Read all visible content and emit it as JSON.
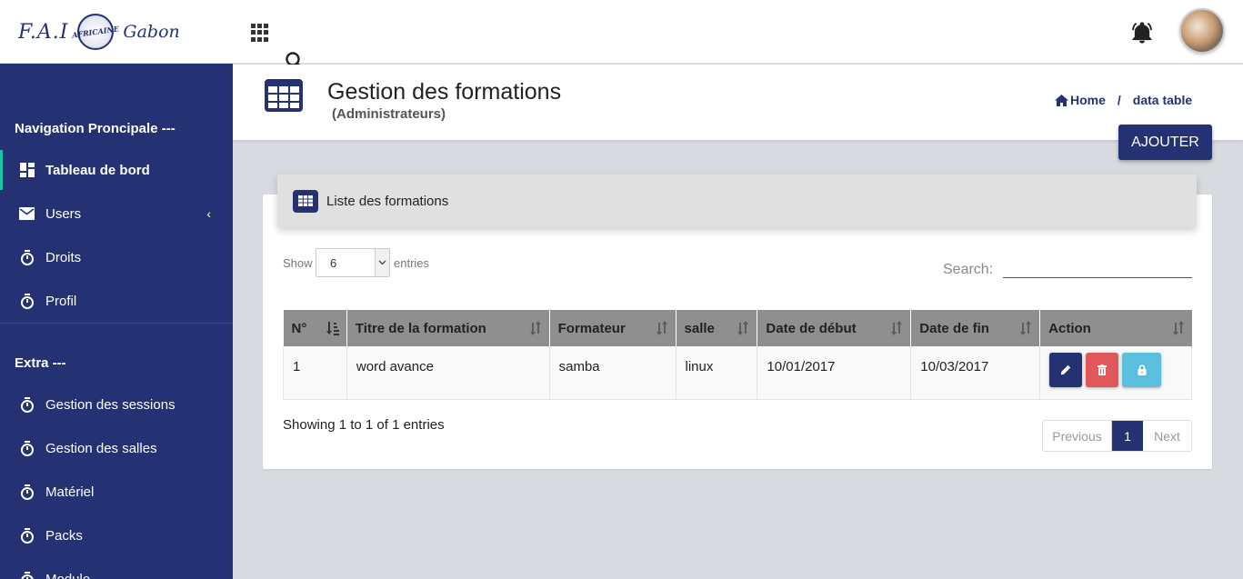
{
  "logo": {
    "left": "F.A.I",
    "emblem": "AFRICAINE",
    "right": "Gabon"
  },
  "sidebar": {
    "heading_main": "Navigation Proncipale ---",
    "items_main": [
      {
        "label": "Tableau de bord",
        "icon": "dashboard-icon",
        "active": true
      },
      {
        "label": "Users",
        "icon": "envelope-icon",
        "has_submenu": true
      },
      {
        "label": "Droits",
        "icon": "timer-icon"
      },
      {
        "label": "Profil",
        "icon": "timer-icon"
      }
    ],
    "heading_extra": "Extra ---",
    "items_extra": [
      {
        "label": "Gestion des sessions",
        "icon": "timer-icon"
      },
      {
        "label": "Gestion des salles",
        "icon": "timer-icon"
      },
      {
        "label": "Matériel",
        "icon": "timer-icon"
      },
      {
        "label": "Packs",
        "icon": "timer-icon"
      },
      {
        "label": "Module",
        "icon": "timer-icon"
      }
    ],
    "chevron": "‹"
  },
  "header": {
    "title": "Gestion des formations",
    "subtitle": "(Administrateurs)",
    "breadcrumb_home": "Home",
    "breadcrumb_sep": "/",
    "breadcrumb_current": "data table",
    "add_button": "AJOUTER"
  },
  "card": {
    "title": "Liste des formations",
    "show_label": "Show",
    "show_value": "6",
    "entries_label": "entries",
    "search_label": "Search:",
    "search_value": ""
  },
  "table": {
    "columns": [
      "N°",
      "Titre de la formation",
      "Formateur",
      "salle",
      "Date de début",
      "Date de fin",
      "Action"
    ],
    "rows": [
      {
        "num": "1",
        "titre": "word avance",
        "formateur": "samba",
        "salle": "linux",
        "debut": "10/01/2017",
        "fin": "10/03/2017"
      }
    ]
  },
  "footer": {
    "info": "Showing 1 to 1 of 1 entries",
    "prev": "Previous",
    "page": "1",
    "next": "Next"
  },
  "colors": {
    "primary": "#243273",
    "accent": "#17c5a3",
    "danger": "#e0585a",
    "info": "#5bc0de"
  }
}
